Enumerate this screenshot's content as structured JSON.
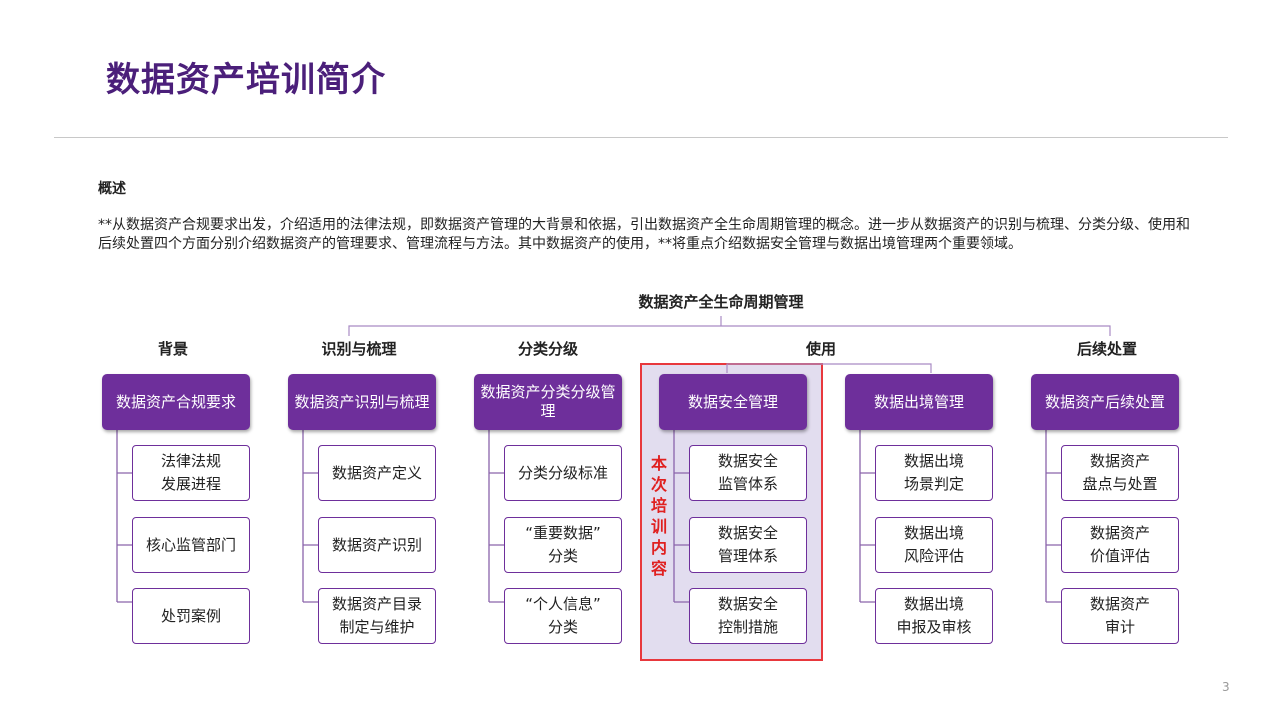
{
  "title": "数据资产培训简介",
  "overview": {
    "heading": "概述",
    "body": "**从数据资产合规要求出发，介绍适用的法律法规，即数据资产管理的大背景和依据，引出数据资产全生命周期管理的概念。进一步从数据资产的识别与梳理、分类分级、使用和后续处置四个方面分别介绍数据资产的管理要求、管理流程与方法。其中数据资产的使用，**将重点介绍数据安全管理与数据出境管理两个重要领域。"
  },
  "diagram": {
    "lifecycle_title": "数据资产全生命周期管理",
    "column_labels": [
      "背景",
      "识别与梳理",
      "分类分级",
      "使用",
      "后续处置"
    ],
    "focus_label": "本次培训内容",
    "heads": [
      "数据资产合规要求",
      "数据资产识别与梳理",
      "数据资产分类分级管理",
      "数据安全管理",
      "数据出境管理",
      "数据资产后续处置"
    ],
    "subitems": [
      [
        "法律法规\n发展进程",
        "核心监管部门",
        "处罚案例"
      ],
      [
        "数据资产定义",
        "数据资产识别",
        "数据资产目录\n制定与维护"
      ],
      [
        "分类分级标准",
        "“重要数据”\n分类",
        "“个人信息”\n分类"
      ],
      [
        "数据安全\n监管体系",
        "数据安全\n管理体系",
        "数据安全\n控制措施"
      ],
      [
        "数据出境\n场景判定",
        "数据出境\n风险评估",
        "数据出境\n申报及审核"
      ],
      [
        "数据资产\n盘点与处置",
        "数据资产\n价值评估",
        "数据资产\n审计"
      ]
    ],
    "colors": {
      "head_fill": "#6e2f9b",
      "title_text": "#4b1f7a",
      "highlight_fill": "#e2ddef",
      "highlight_border": "#e8383d",
      "focus_text": "#e02020"
    }
  },
  "page_number": "3"
}
